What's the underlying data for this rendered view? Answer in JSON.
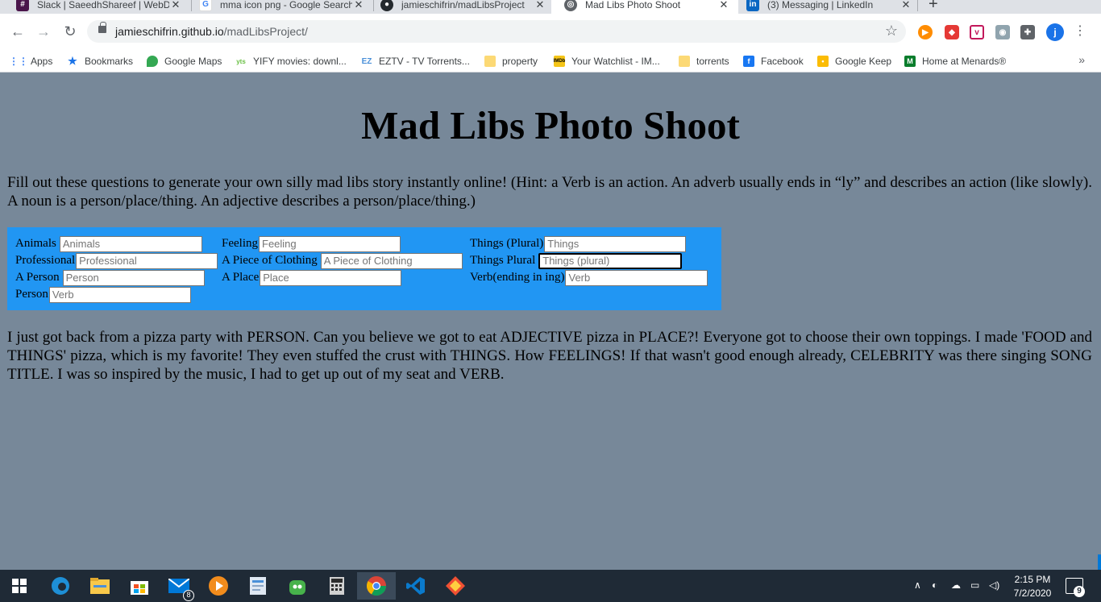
{
  "browser": {
    "tabs": [
      {
        "title": "Slack | SaeedhShareef | WebDe",
        "icon": "slack-icon",
        "color": "#4a154b"
      },
      {
        "title": "mma icon png - Google Search",
        "icon": "google-icon",
        "color": "#4285f4"
      },
      {
        "title": "jamieschifrin/madLibsProject",
        "icon": "github-icon",
        "color": "#24292e"
      },
      {
        "title": "Mad Libs Photo Shoot",
        "icon": "globe-icon",
        "color": "#5f6368",
        "active": true
      },
      {
        "title": "(3) Messaging | LinkedIn",
        "icon": "linkedin-icon",
        "color": "#0a66c2"
      }
    ],
    "close_glyph": "✕",
    "new_tab_glyph": "+",
    "url_host": "jamieschifrin.github.io",
    "url_path": "/madLibsProject/",
    "profile_initial": "j",
    "bookmarks": [
      {
        "label": "Apps",
        "icon": "apps-grid-icon"
      },
      {
        "label": "Bookmarks",
        "icon": "star-icon"
      },
      {
        "label": "Google Maps",
        "icon": "maps-pin-icon"
      },
      {
        "label": "YIFY movies: downl...",
        "icon": "yts-icon"
      },
      {
        "label": "EZTV - TV Torrents...",
        "icon": "eztv-icon"
      },
      {
        "label": "property",
        "icon": "folder-icon"
      },
      {
        "label": "Your Watchlist - IM...",
        "icon": "imdb-icon"
      },
      {
        "label": "torrents",
        "icon": "folder-icon"
      },
      {
        "label": "Facebook",
        "icon": "facebook-icon"
      },
      {
        "label": "Google Keep",
        "icon": "keep-icon"
      },
      {
        "label": "Home at Menards®",
        "icon": "menards-icon"
      }
    ],
    "bookmarks_more": "»"
  },
  "page": {
    "title": "Mad Libs Photo Shoot",
    "background": "#778899",
    "form_background": "#2196f3",
    "intro": "Fill out these questions to generate your own silly mad libs story instantly online! (Hint: a Verb is an action. An adverb usually ends in “ly” and describes an action (like slowly). A noun is a person/place/thing. An adjective describes a person/place/thing.)",
    "fields": [
      {
        "label": "Animals",
        "placeholder": "Animals"
      },
      {
        "label": "Feeling",
        "placeholder": "Feeling"
      },
      {
        "label": "Things (Plural)",
        "placeholder": "Things"
      },
      {
        "label": "Professional",
        "placeholder": "Professional"
      },
      {
        "label": "A Piece of Clothing",
        "placeholder": "A Piece of Clothing"
      },
      {
        "label": "Things Plural",
        "placeholder": "Things (plural)"
      },
      {
        "label": "A Person",
        "placeholder": "Person"
      },
      {
        "label": "A Place",
        "placeholder": "Place"
      },
      {
        "label": "Verb(ending in ing)",
        "placeholder": "Verb"
      },
      {
        "label": "Person",
        "placeholder": "Verb"
      }
    ],
    "story": "I just got back from a pizza party with PERSON. Can you believe we got to eat ADJECTIVE pizza in PLACE?! Everyone got to choose their own toppings. I made 'FOOD and THINGS' pizza, which is my favorite! They even stuffed the crust with THINGS. How FEELINGS! If that wasn't good enough already, CELEBRITY was there singing SONG TITLE. I was so inspired by the music, I had to get up out of my seat and VERB."
  },
  "taskbar": {
    "mail_badge": "8",
    "time": "2:15 PM",
    "date": "7/2/2020",
    "notification_count": "9"
  }
}
